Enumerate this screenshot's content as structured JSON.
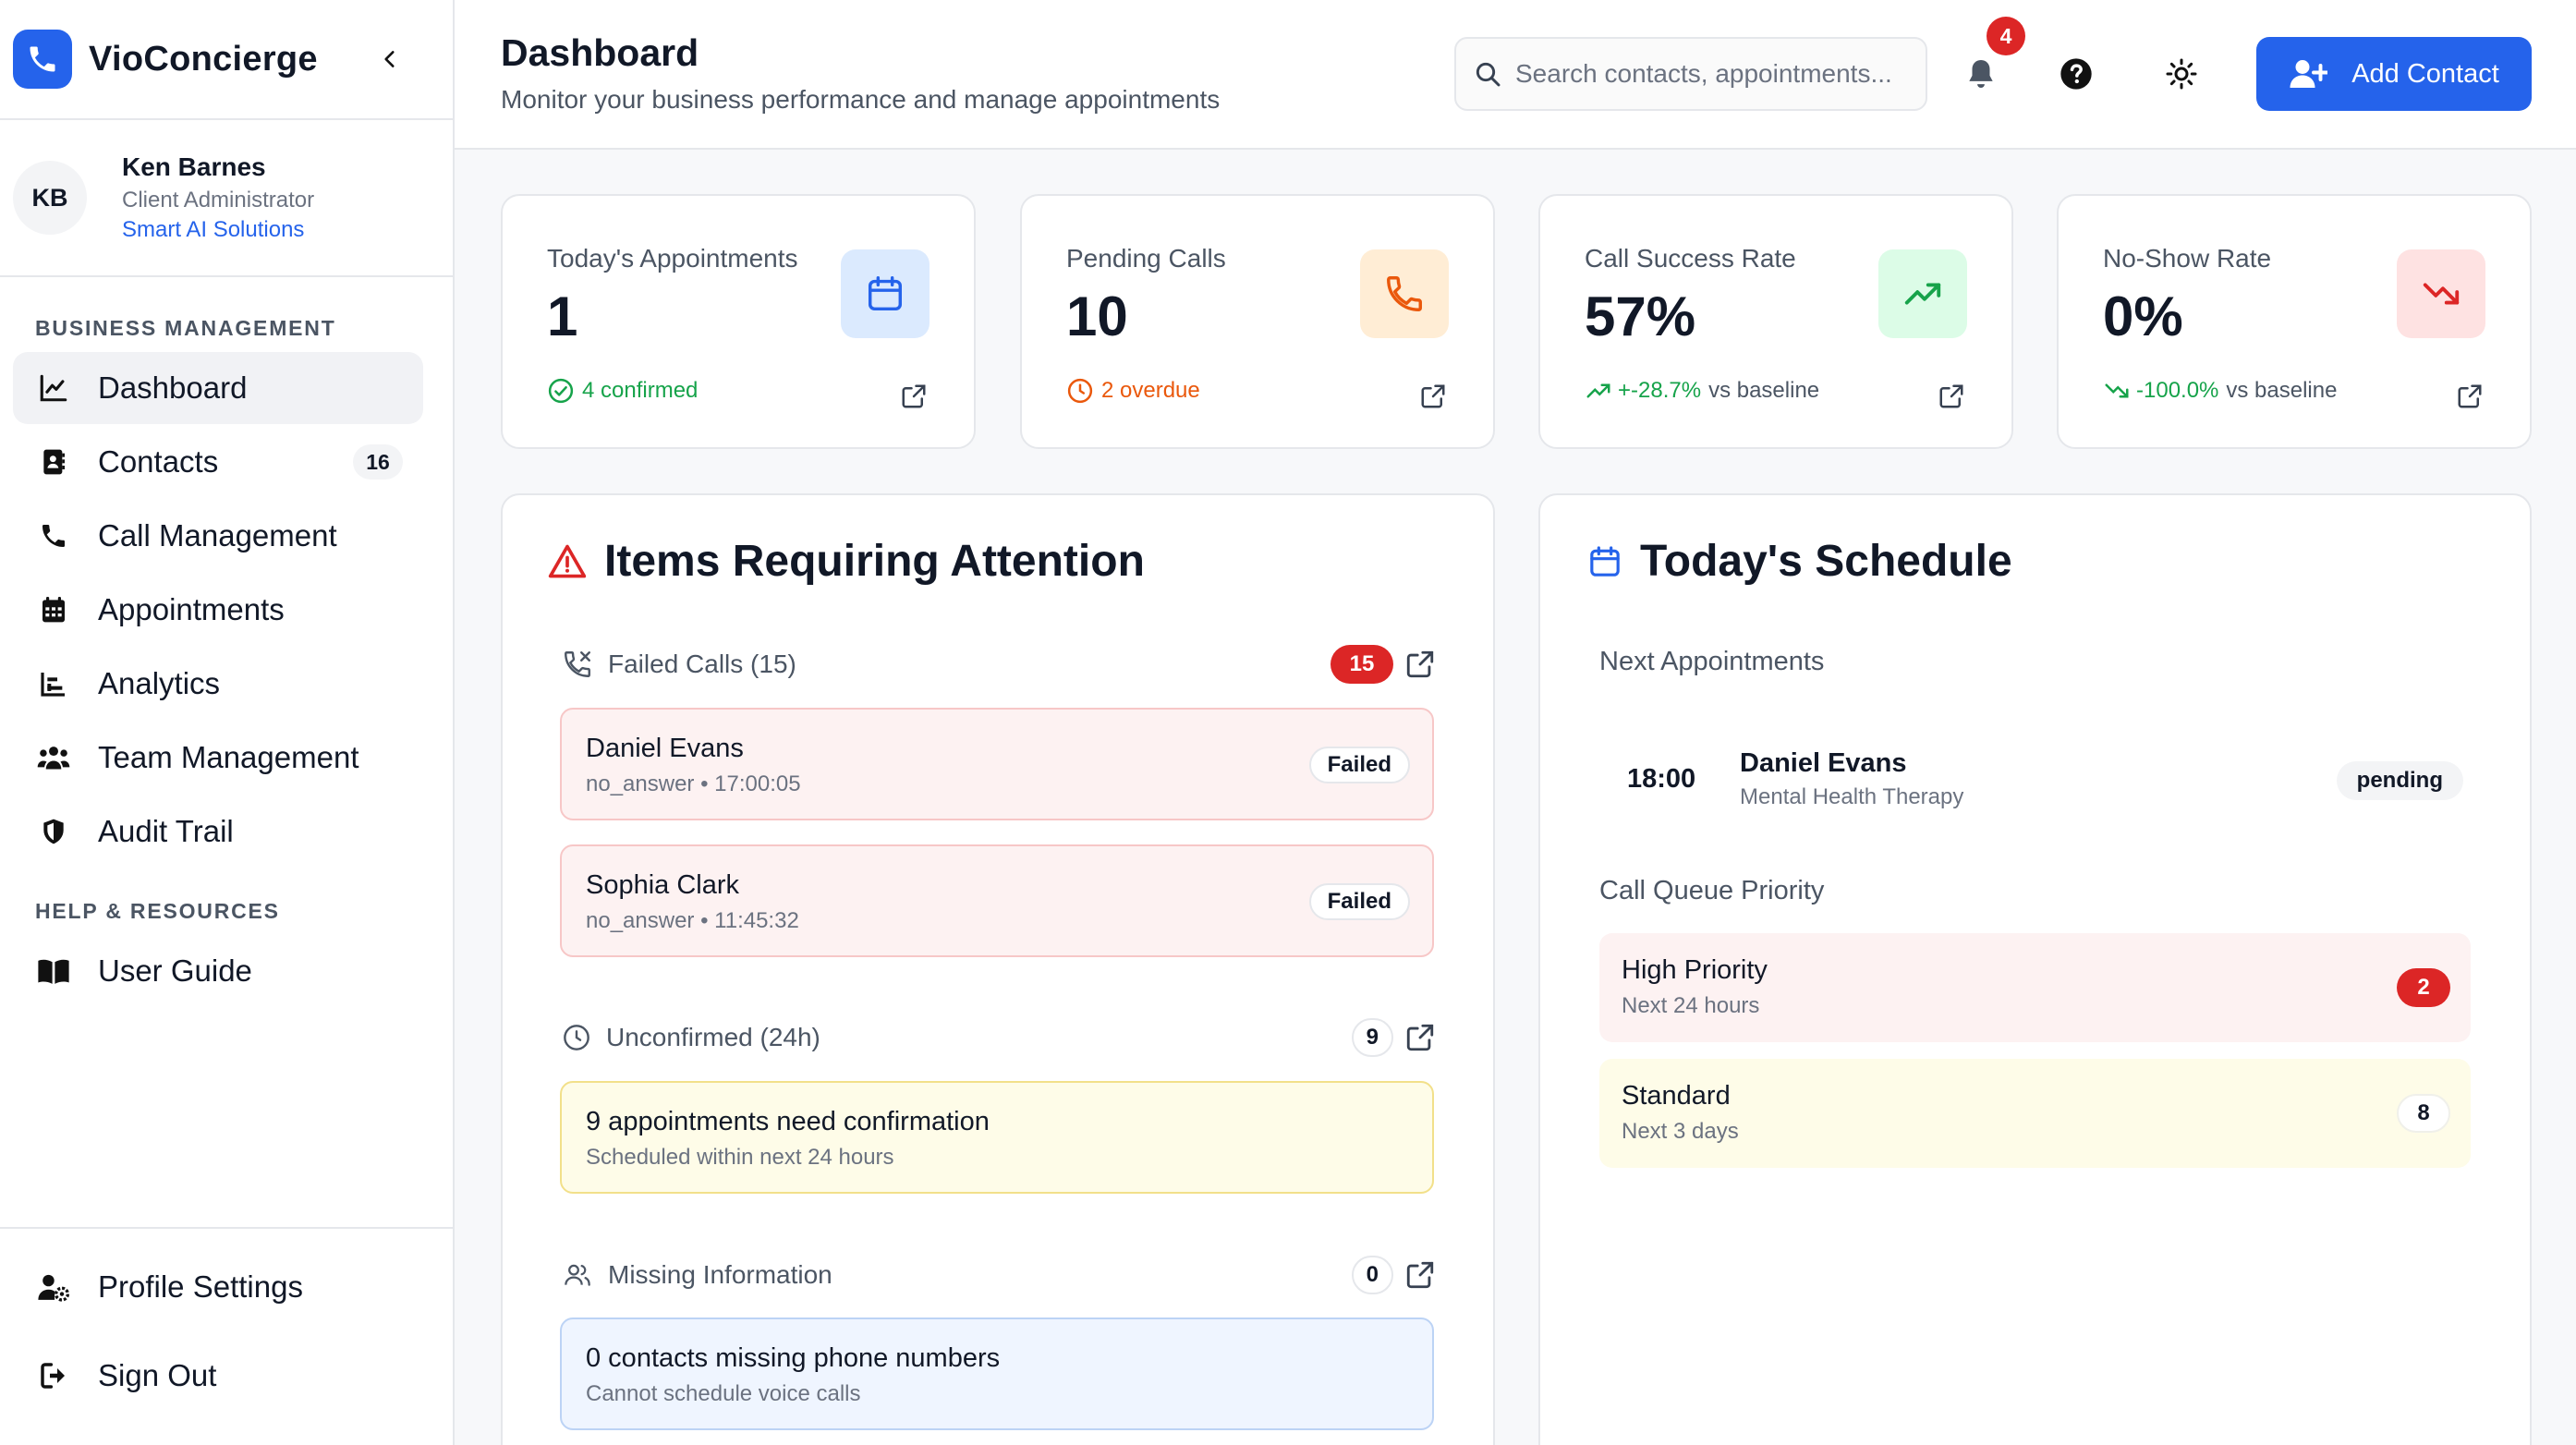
{
  "brand": {
    "name": "VioConcierge",
    "accent": "#2563eb"
  },
  "user": {
    "initials": "KB",
    "name": "Ken Barnes",
    "role": "Client Administrator",
    "org": "Smart AI Solutions"
  },
  "sidebar": {
    "section_business": "BUSINESS MANAGEMENT",
    "items": [
      {
        "label": "Dashboard",
        "icon": "chart-line-icon",
        "active": true
      },
      {
        "label": "Contacts",
        "icon": "address-book-icon",
        "badge": "16"
      },
      {
        "label": "Call Management",
        "icon": "phone-icon"
      },
      {
        "label": "Appointments",
        "icon": "calendar-grid-icon"
      },
      {
        "label": "Analytics",
        "icon": "bar-chart-icon"
      },
      {
        "label": "Team Management",
        "icon": "users-icon"
      },
      {
        "label": "Audit Trail",
        "icon": "shield-icon"
      }
    ],
    "section_help": "HELP & RESOURCES",
    "help_items": [
      {
        "label": "User Guide",
        "icon": "book-icon"
      }
    ],
    "bottom_items": [
      {
        "label": "Profile Settings",
        "icon": "user-cog-icon"
      },
      {
        "label": "Sign Out",
        "icon": "sign-out-icon"
      }
    ]
  },
  "header": {
    "title": "Dashboard",
    "subtitle": "Monitor your business performance and manage appointments",
    "search_placeholder": "Search contacts, appointments...",
    "notification_count": "4",
    "add_button": "Add Contact"
  },
  "stats": [
    {
      "label": "Today's Appointments",
      "value": "1",
      "foot_main": "4 confirmed",
      "foot_muted": "",
      "foot_color": "#16a34a",
      "icon": "calendar-icon",
      "icon_bg": "#dbeafe",
      "icon_color": "#2563eb"
    },
    {
      "label": "Pending Calls",
      "value": "10",
      "foot_main": "2 overdue",
      "foot_muted": "",
      "foot_color": "#ea580c",
      "icon": "phone-icon",
      "icon_bg": "#ffedd5",
      "icon_color": "#ea580c"
    },
    {
      "label": "Call Success Rate",
      "value": "57%",
      "foot_main": "+-28.7%",
      "foot_muted": "vs baseline",
      "foot_color": "#16a34a",
      "icon": "trend-up-icon",
      "icon_bg": "#dcfce7",
      "icon_color": "#16a34a"
    },
    {
      "label": "No-Show Rate",
      "value": "0%",
      "foot_main": "-100.0%",
      "foot_muted": "vs baseline",
      "foot_color": "#16a34a",
      "icon": "trend-down-icon",
      "icon_bg": "#fee2e2",
      "icon_color": "#dc2626"
    }
  ],
  "attention": {
    "title": "Items Requiring Attention",
    "failed": {
      "label": "Failed Calls (15)",
      "count": "15",
      "items": [
        {
          "name": "Daniel Evans",
          "detail": "no_answer • 17:00:05",
          "status": "Failed"
        },
        {
          "name": "Sophia Clark",
          "detail": "no_answer • 11:45:32",
          "status": "Failed"
        }
      ]
    },
    "unconfirmed": {
      "label": "Unconfirmed (24h)",
      "count": "9",
      "item": {
        "title": "9 appointments need confirmation",
        "sub": "Scheduled within next 24 hours"
      }
    },
    "missing": {
      "label": "Missing Information",
      "count": "0",
      "item": {
        "title": "0 contacts missing phone numbers",
        "sub": "Cannot schedule voice calls"
      }
    }
  },
  "schedule": {
    "title": "Today's Schedule",
    "next_label": "Next Appointments",
    "appointment": {
      "time": "18:00",
      "name": "Daniel Evans",
      "type": "Mental Health Therapy",
      "status": "pending"
    },
    "queue_label": "Call Queue Priority",
    "queue": [
      {
        "title": "High Priority",
        "sub": "Next 24 hours",
        "count": "2"
      },
      {
        "title": "Standard",
        "sub": "Next 3 days",
        "count": "8"
      }
    ]
  }
}
